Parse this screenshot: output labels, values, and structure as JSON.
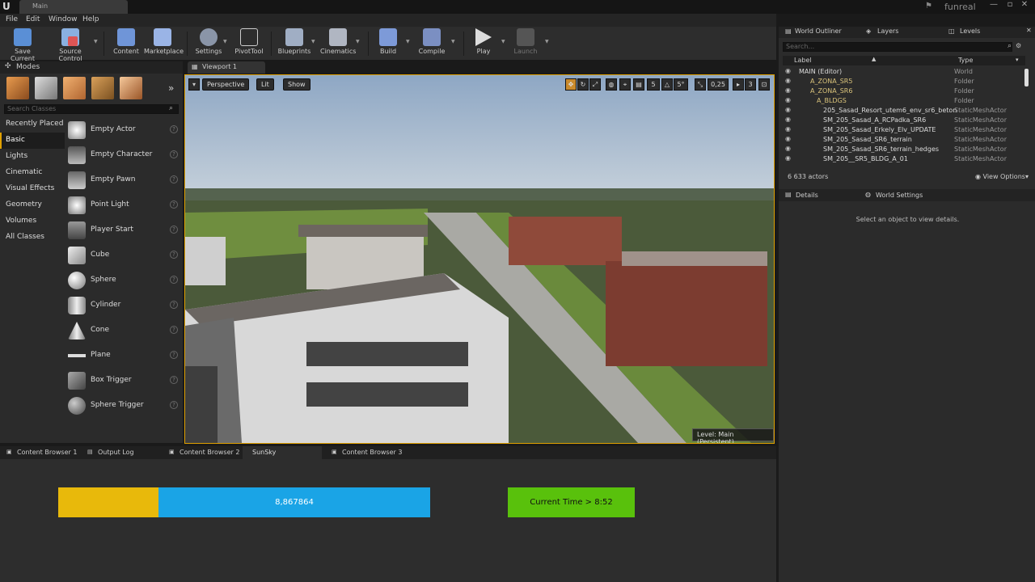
{
  "title_bar": {
    "tab": "Main",
    "project": "funreal"
  },
  "menu": [
    "File",
    "Edit",
    "Window",
    "Help"
  ],
  "toolbar": {
    "save_current": "Save Current",
    "source_control": "Source Control",
    "content": "Content",
    "marketplace": "Marketplace",
    "settings": "Settings",
    "pivot_tool": "PivotTool",
    "blueprints": "Blueprints",
    "cinematics": "Cinematics",
    "build": "Build",
    "compile": "Compile",
    "play": "Play",
    "launch": "Launch"
  },
  "modes": {
    "title": "Modes",
    "search_placeholder": "Search Classes",
    "categories": [
      "Recently Placed",
      "Basic",
      "Lights",
      "Cinematic",
      "Visual Effects",
      "Geometry",
      "Volumes",
      "All Classes"
    ],
    "active_category": "Basic",
    "items": [
      "Empty Actor",
      "Empty Character",
      "Empty Pawn",
      "Point Light",
      "Player Start",
      "Cube",
      "Sphere",
      "Cylinder",
      "Cone",
      "Plane",
      "Box Trigger",
      "Sphere Trigger"
    ]
  },
  "viewport": {
    "tab": "Viewport 1",
    "perspective": "Perspective",
    "lit": "Lit",
    "show": "Show",
    "grid_snap": "5",
    "rot_snap": "5°",
    "scale_snap": "0,25",
    "camera_speed": "3",
    "level": "Level:  Main (Persistent)"
  },
  "bottom_tabs": [
    "Content Browser 1",
    "Output Log",
    "Content Browser 2",
    "SunSky",
    "Content Browser 3"
  ],
  "bottom_panel": {
    "value": "8,867864",
    "time": "Current Time  > 8:52",
    "progress_fraction": 0.27
  },
  "outliner": {
    "tabs": [
      "World Outliner",
      "Layers",
      "Levels"
    ],
    "search_placeholder": "Search...",
    "col_label": "Label",
    "col_type": "Type",
    "rows": [
      {
        "name": "MAIN (Editor)",
        "type": "World"
      },
      {
        "name": "A_ZONA_SR5",
        "type": "Folder"
      },
      {
        "name": "A_ZONA_SR6",
        "type": "Folder"
      },
      {
        "name": "A_BLDGS",
        "type": "Folder"
      },
      {
        "name": "205_Sasad_Resort_utem6_env_sr6_beton",
        "type": "StaticMeshActor"
      },
      {
        "name": "SM_205_Sasad_A_RCPadka_SR6",
        "type": "StaticMeshActor"
      },
      {
        "name": "SM_205_Sasad_Erkely_Elv_UPDATE",
        "type": "StaticMeshActor"
      },
      {
        "name": "SM_205_Sasad_SR6_terrain",
        "type": "StaticMeshActor"
      },
      {
        "name": "SM_205_Sasad_SR6_terrain_hedges",
        "type": "StaticMeshActor"
      },
      {
        "name": "SM_205__SR5_BLDG_A_01",
        "type": "StaticMeshActor"
      }
    ],
    "actors": "6 633 actors",
    "view_options": "View Options"
  },
  "details": {
    "tabs": [
      "Details",
      "World Settings"
    ],
    "message": "Select an object to view details."
  },
  "colors": {
    "accent": "#e0a000",
    "blue": "#1aa4e6",
    "yellow": "#e8b90b",
    "green": "#59c10c"
  }
}
